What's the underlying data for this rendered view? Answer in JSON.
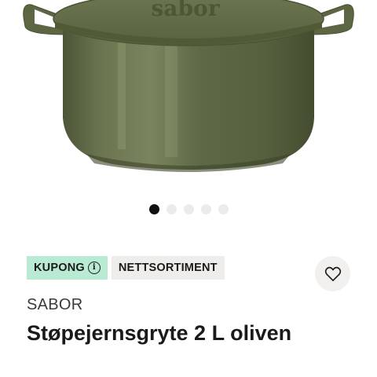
{
  "carousel": {
    "total": 5,
    "active_index": 0
  },
  "badges": {
    "coupon_label": "KUPONG",
    "online_label": "NETTSORTIMENT"
  },
  "product": {
    "brand": "SABOR",
    "title": "Støpejernsgryte 2 L oliven",
    "lid_embossing": "sabor",
    "color": "#5f6a48"
  },
  "icons": {
    "coupon_info": "info-icon",
    "favorite": "heart-outline-icon"
  },
  "colors": {
    "coupon_badge": "#b9ead4",
    "online_badge": "#efedeb",
    "active_dot": "#111111",
    "inactive_dot": "#ecebeb"
  }
}
